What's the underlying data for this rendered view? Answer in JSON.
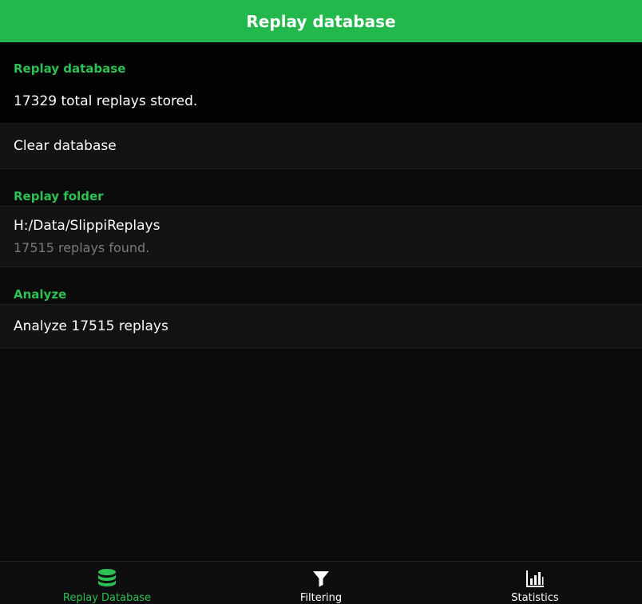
{
  "header": {
    "title": "Replay database"
  },
  "sections": {
    "database": {
      "header": "Replay database",
      "summary": "17329 total replays stored.",
      "clear_label": "Clear database"
    },
    "folder": {
      "header": "Replay folder",
      "path": "H:/Data/SlippiReplays",
      "found": "17515 replays found."
    },
    "analyze": {
      "header": "Analyze",
      "action_label": "Analyze 17515 replays"
    }
  },
  "nav": {
    "items": [
      {
        "label": "Replay Database",
        "icon": "database-icon",
        "active": true
      },
      {
        "label": "Filtering",
        "icon": "filter-icon",
        "active": false
      },
      {
        "label": "Statistics",
        "icon": "bar-chart-icon",
        "active": false
      }
    ]
  },
  "colors": {
    "accent": "#22b84c",
    "accent_text": "#2dc052",
    "background": "#0b0b0b",
    "row_background": "#131313"
  }
}
